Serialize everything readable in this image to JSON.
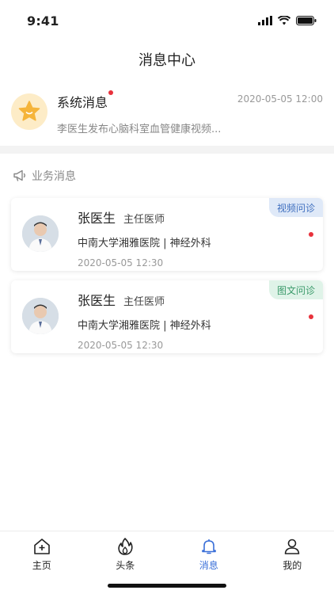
{
  "status": {
    "time": "9:41"
  },
  "header": {
    "title": "消息中心"
  },
  "system": {
    "title": "系统消息",
    "time": "2020-05-05 12:00",
    "desc": "李医生发布心脑科室血管健康视频..."
  },
  "section": {
    "title": "业务消息"
  },
  "cards": [
    {
      "name": "张医生",
      "title": "主任医师",
      "hospital": "中南大学湘雅医院 | 神经外科",
      "time": "2020-05-05 12:30",
      "tag": "视频问诊"
    },
    {
      "name": "张医生",
      "title": "主任医师",
      "hospital": "中南大学湘雅医院 | 神经外科",
      "time": "2020-05-05 12:30",
      "tag": "图文问诊"
    }
  ],
  "tabbar": {
    "items": [
      {
        "label": "主页",
        "icon": "home-icon"
      },
      {
        "label": "头条",
        "icon": "flame-icon"
      },
      {
        "label": "消息",
        "icon": "bell-icon"
      },
      {
        "label": "我的",
        "icon": "person-icon"
      }
    ]
  },
  "colors": {
    "accent": "#3a6fd8",
    "unread": "#e8323c",
    "video_tag": "#3f6fbf",
    "text_tag": "#3a9a6a"
  }
}
